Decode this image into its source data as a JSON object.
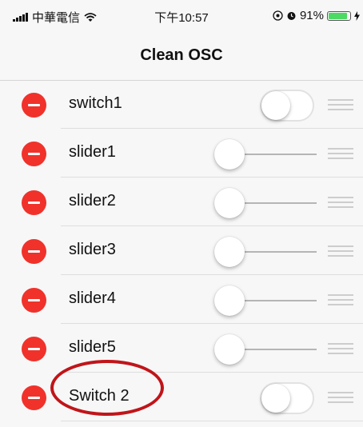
{
  "status_bar": {
    "carrier": "中華電信",
    "time": "下午10:57",
    "battery_percent": "91%",
    "battery_level": 0.91,
    "icons": [
      "signal-icon",
      "wifi-icon",
      "location-icon",
      "alarm-icon",
      "battery-icon",
      "charging-icon"
    ]
  },
  "nav": {
    "title": "Clean OSC"
  },
  "rows": [
    {
      "label": "switch1",
      "control": "toggle",
      "on": false
    },
    {
      "label": "slider1",
      "control": "slider",
      "value": 0
    },
    {
      "label": "slider2",
      "control": "slider",
      "value": 0
    },
    {
      "label": "slider3",
      "control": "slider",
      "value": 0
    },
    {
      "label": "slider4",
      "control": "slider",
      "value": 0
    },
    {
      "label": "slider5",
      "control": "slider",
      "value": 0
    },
    {
      "label": "Switch 2",
      "control": "toggle",
      "on": false
    }
  ],
  "colors": {
    "delete": "#f0322b",
    "toggle_on": "#4cd964",
    "annotation": "#c0151a"
  }
}
